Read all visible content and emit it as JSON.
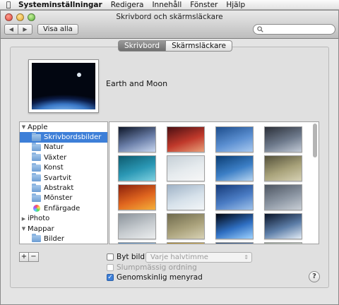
{
  "menubar": {
    "apple_icon": "apple-logo",
    "items": [
      "Systeminställningar",
      "Redigera",
      "Innehåll",
      "Fönster",
      "Hjälp"
    ]
  },
  "window": {
    "title": "Skrivbord och skärmsläckare",
    "show_all": "Visa alla",
    "search_placeholder": ""
  },
  "tabs": [
    {
      "label": "Skrivbord",
      "active": true
    },
    {
      "label": "Skärmsläckare",
      "active": false
    }
  ],
  "current_picture": {
    "name": "Earth and Moon"
  },
  "sources": [
    {
      "label": "Apple",
      "type": "group",
      "expanded": true
    },
    {
      "label": "Skrivbordsbilder",
      "type": "folder",
      "selected": true
    },
    {
      "label": "Natur",
      "type": "folder"
    },
    {
      "label": "Växter",
      "type": "folder"
    },
    {
      "label": "Konst",
      "type": "folder"
    },
    {
      "label": "Svartvit",
      "type": "folder"
    },
    {
      "label": "Abstrakt",
      "type": "folder"
    },
    {
      "label": "Mönster",
      "type": "folder"
    },
    {
      "label": "Enfärgade",
      "type": "solid-colors"
    },
    {
      "label": "iPhoto",
      "type": "group",
      "expanded": false
    },
    {
      "label": "Mappar",
      "type": "group",
      "expanded": true
    },
    {
      "label": "Bilder",
      "type": "folder"
    }
  ],
  "thumbnails": [
    {
      "name": "galaxy",
      "colors": [
        "#0d1527",
        "#6a7ea8",
        "#c9d7f0"
      ]
    },
    {
      "name": "red-canyon",
      "colors": [
        "#4a0f12",
        "#c0392b",
        "#e8a07a"
      ]
    },
    {
      "name": "blue-wave",
      "colors": [
        "#1d4d8c",
        "#5b8fd1",
        "#a9c9ef"
      ]
    },
    {
      "name": "gray-streak",
      "colors": [
        "#2b2f38",
        "#6e7a8c",
        "#c2cad6"
      ]
    },
    {
      "name": "teal-water",
      "colors": [
        "#0d5a6e",
        "#2b98b5",
        "#7fd1e0"
      ]
    },
    {
      "name": "pale-sky",
      "colors": [
        "#c5cfd6",
        "#e6ebee",
        "#f7f7f7"
      ]
    },
    {
      "name": "blue-reeds",
      "colors": [
        "#0b3d73",
        "#3c7fc6",
        "#b6d4f0"
      ]
    },
    {
      "name": "dry-grass",
      "colors": [
        "#54513a",
        "#a8a27a",
        "#d6d1b4"
      ]
    },
    {
      "name": "autumn-leaves",
      "colors": [
        "#8a1f0b",
        "#e0661f",
        "#f4b03a"
      ]
    },
    {
      "name": "frosty-glass",
      "colors": [
        "#9fb2c6",
        "#d6e1ea",
        "#f3f6f8"
      ]
    },
    {
      "name": "blue-abstract",
      "colors": [
        "#163a78",
        "#4a7cc4",
        "#9fc2ea"
      ]
    },
    {
      "name": "gray-horizon",
      "colors": [
        "#4d5561",
        "#8c96a3",
        "#c9cfd6"
      ]
    },
    {
      "name": "misty-lake",
      "colors": [
        "#8b939b",
        "#c6cbcf",
        "#eceeef"
      ]
    },
    {
      "name": "foggy-forest",
      "colors": [
        "#6f6a4c",
        "#aaa27c",
        "#d8d2b5"
      ]
    },
    {
      "name": "earth-and-moon",
      "colors": [
        "#02060f",
        "#2f6fc2",
        "#9ed2ff"
      ]
    },
    {
      "name": "earth-clouds",
      "colors": [
        "#0a1428",
        "#5d7ea8",
        "#e3ecf6"
      ]
    },
    {
      "name": "blue-haze",
      "colors": [
        "#5b8fc4",
        "#a8c6e2",
        "#e4eef7"
      ]
    },
    {
      "name": "golden-field",
      "colors": [
        "#b08a2c",
        "#e0c06a",
        "#f4e3a8"
      ]
    },
    {
      "name": "rain-drops",
      "colors": [
        "#2f4f7a",
        "#6c90bf",
        "#bcd2ea"
      ]
    },
    {
      "name": "white-plants",
      "colors": [
        "#9aa79a",
        "#d3dbd3",
        "#f5f7f5"
      ]
    }
  ],
  "controls": {
    "add": "+",
    "remove": "−",
    "change_picture": {
      "label": "Byt bild:",
      "checked": false
    },
    "interval": "Varje halvtimme",
    "random_order": {
      "label": "Slumpmässig ordning",
      "checked": false,
      "disabled": true
    },
    "translucent_menu": {
      "label": "Genomskinlig menyrad",
      "checked": true
    },
    "help": "?"
  }
}
